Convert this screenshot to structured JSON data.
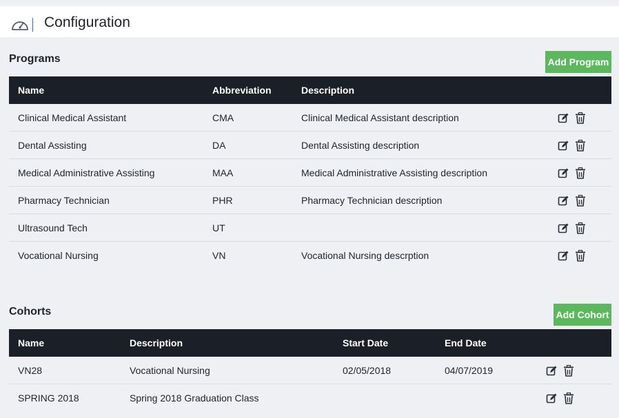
{
  "header": {
    "title": "Configuration",
    "icon": "dashboard-gauge-icon"
  },
  "programs": {
    "title": "Programs",
    "add_label": "Add Program",
    "columns": [
      "Name",
      "Abbreviation",
      "Description"
    ],
    "rows": [
      {
        "name": "Clinical Medical Assistant",
        "abbr": "CMA",
        "desc": "Clinical Medical Assistant description"
      },
      {
        "name": "Dental Assisting",
        "abbr": "DA",
        "desc": "Dental Assisting description"
      },
      {
        "name": "Medical Administrative Assisting",
        "abbr": "MAA",
        "desc": "Medical Administrative Assisting description"
      },
      {
        "name": "Pharmacy Technician",
        "abbr": "PHR",
        "desc": "Pharmacy Technician description"
      },
      {
        "name": "Ultrasound Tech",
        "abbr": "UT",
        "desc": ""
      },
      {
        "name": "Vocational Nursing",
        "abbr": "VN",
        "desc": "Vocational Nursing descrption"
      }
    ]
  },
  "cohorts": {
    "title": "Cohorts",
    "add_label": "Add Cohort",
    "columns": [
      "Name",
      "Description",
      "Start Date",
      "End Date"
    ],
    "rows": [
      {
        "name": "VN28",
        "desc": "Vocational Nursing",
        "start": "02/05/2018",
        "end": "04/07/2019"
      },
      {
        "name": "SPRING 2018",
        "desc": "Spring 2018 Graduation Class",
        "start": "",
        "end": ""
      }
    ]
  },
  "colors": {
    "header_bg": "#1b1f27",
    "add_button": "#5cb85c",
    "page_bg": "#eef0f4"
  },
  "icons": {
    "edit": "edit-icon",
    "delete": "trash-icon"
  }
}
